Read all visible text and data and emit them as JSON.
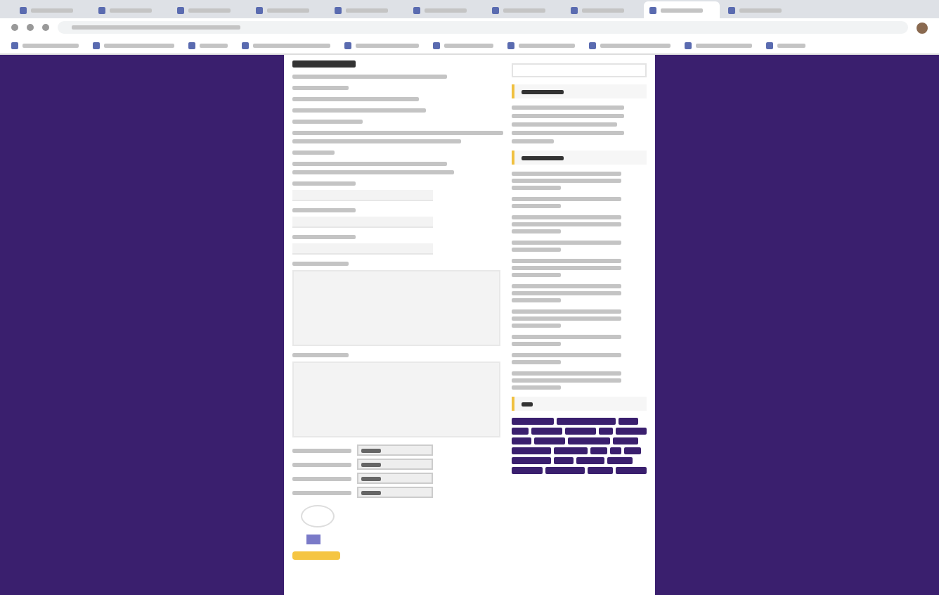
{
  "browser": {
    "tabs": [
      {
        "selected": false
      },
      {
        "selected": false
      },
      {
        "selected": false
      },
      {
        "selected": false
      },
      {
        "selected": false
      },
      {
        "selected": false
      },
      {
        "selected": false
      },
      {
        "selected": false
      },
      {
        "selected": true
      },
      {
        "selected": false
      }
    ]
  },
  "form": {
    "items": [
      {
        "kind": "input"
      },
      {
        "kind": "input"
      },
      {
        "kind": "input"
      },
      {
        "kind": "textarea"
      },
      {
        "kind": "textarea"
      }
    ],
    "selects": [
      {
        "kind": "select"
      },
      {
        "kind": "select"
      },
      {
        "kind": "select"
      },
      {
        "kind": "select"
      }
    ]
  },
  "sidebar": {
    "sections": [
      {
        "kind": "text"
      },
      {
        "kind": "list"
      },
      {
        "kind": "tags"
      }
    ]
  }
}
